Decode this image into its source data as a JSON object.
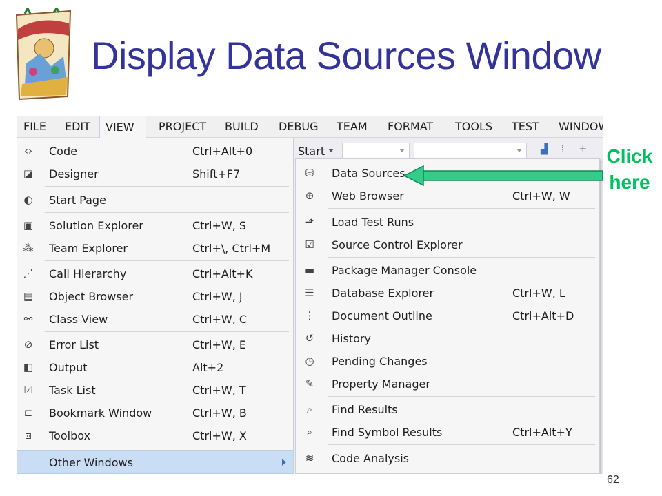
{
  "slide": {
    "title": "Display Data Sources Window",
    "page_number": "62",
    "annotation": [
      "Click",
      "here"
    ]
  },
  "menubar": {
    "items": [
      "FILE",
      "EDIT",
      "VIEW",
      "PROJECT",
      "BUILD",
      "DEBUG",
      "TEAM",
      "FORMAT",
      "TOOLS",
      "TEST",
      "WINDOW"
    ],
    "active": "VIEW"
  },
  "toolbar": {
    "start_label": "Start"
  },
  "view_menu": {
    "items": [
      {
        "label": "Code",
        "shortcut": "Ctrl+Alt+0",
        "icon": "code-icon"
      },
      {
        "label": "Designer",
        "shortcut": "Shift+F7",
        "icon": "designer-icon"
      },
      {
        "label": "Start Page",
        "shortcut": "",
        "icon": "start-page-icon"
      },
      {
        "label": "Solution Explorer",
        "shortcut": "Ctrl+W, S",
        "icon": "solution-explorer-icon"
      },
      {
        "label": "Team Explorer",
        "shortcut": "Ctrl+\\, Ctrl+M",
        "icon": "team-explorer-icon"
      },
      {
        "label": "Call Hierarchy",
        "shortcut": "Ctrl+Alt+K",
        "icon": "call-hierarchy-icon"
      },
      {
        "label": "Object Browser",
        "shortcut": "Ctrl+W, J",
        "icon": "object-browser-icon"
      },
      {
        "label": "Class View",
        "shortcut": "Ctrl+W, C",
        "icon": "class-view-icon"
      },
      {
        "label": "Error List",
        "shortcut": "Ctrl+W, E",
        "icon": "error-list-icon"
      },
      {
        "label": "Output",
        "shortcut": "Alt+2",
        "icon": "output-icon"
      },
      {
        "label": "Task List",
        "shortcut": "Ctrl+W, T",
        "icon": "task-list-icon"
      },
      {
        "label": "Bookmark Window",
        "shortcut": "Ctrl+W, B",
        "icon": "bookmark-icon"
      },
      {
        "label": "Toolbox",
        "shortcut": "Ctrl+W, X",
        "icon": "toolbox-icon"
      },
      {
        "label": "Other Windows",
        "shortcut": "",
        "icon": ""
      }
    ]
  },
  "other_windows_menu": {
    "items": [
      {
        "label": "Data Sources",
        "shortcut": "",
        "icon": "data-sources-icon"
      },
      {
        "label": "Web Browser",
        "shortcut": "Ctrl+W, W",
        "icon": "web-browser-icon"
      },
      {
        "label": "Load Test Runs",
        "shortcut": "",
        "icon": "load-test-icon"
      },
      {
        "label": "Source Control Explorer",
        "shortcut": "",
        "icon": "source-control-icon"
      },
      {
        "label": "Package Manager Console",
        "shortcut": "",
        "icon": "console-icon"
      },
      {
        "label": "Database Explorer",
        "shortcut": "Ctrl+W, L",
        "icon": "database-icon"
      },
      {
        "label": "Document Outline",
        "shortcut": "Ctrl+Alt+D",
        "icon": "outline-icon"
      },
      {
        "label": "History",
        "shortcut": "",
        "icon": "history-icon"
      },
      {
        "label": "Pending Changes",
        "shortcut": "",
        "icon": "pending-changes-icon"
      },
      {
        "label": "Property Manager",
        "shortcut": "",
        "icon": "wrench-icon"
      },
      {
        "label": "Find Results",
        "shortcut": "",
        "icon": "find-results-icon"
      },
      {
        "label": "Find Symbol Results",
        "shortcut": "Ctrl+Alt+Y",
        "icon": "find-symbol-icon"
      },
      {
        "label": "Code Analysis",
        "shortcut": "",
        "icon": "code-analysis-icon"
      }
    ]
  },
  "colors": {
    "title": "#333399",
    "annotation": "#00c060",
    "highlight": "#c9def5"
  }
}
